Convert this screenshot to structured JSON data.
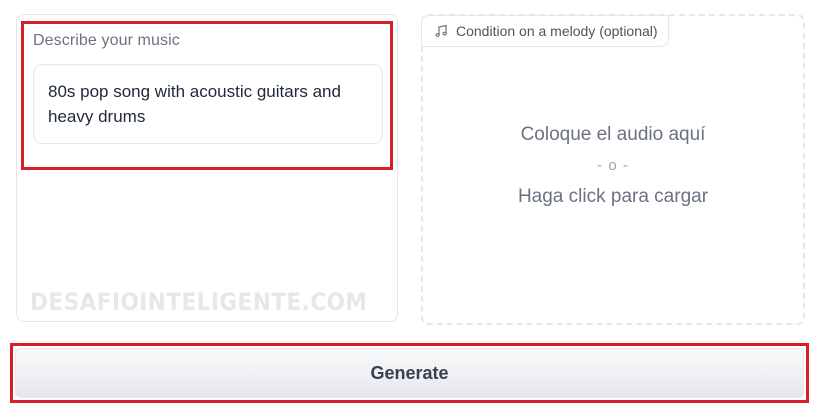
{
  "prompt": {
    "label": "Describe your music",
    "value": "80s pop song with acoustic guitars and heavy drums"
  },
  "melody": {
    "badge_label": "Condition on a melody (optional)",
    "badge_icon": "music-note-icon",
    "drop_text": "Coloque el audio aquí",
    "or_text": "- o -",
    "click_text": "Haga click para cargar"
  },
  "actions": {
    "generate_label": "Generate"
  },
  "watermark": {
    "text": "DESAFIOINTELIGENTE.COM"
  },
  "colors": {
    "highlight": "#d5202a",
    "border": "#e5e7eb",
    "muted_text": "#6b7280"
  }
}
